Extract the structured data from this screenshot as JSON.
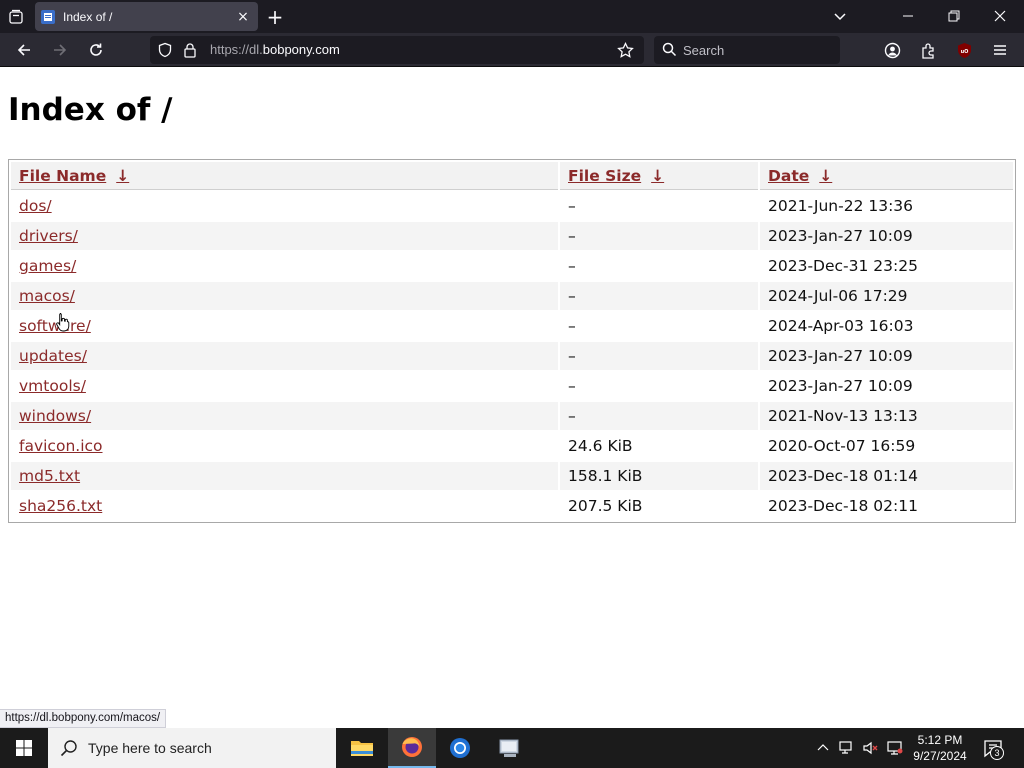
{
  "browser": {
    "tab": {
      "title": "Index of /",
      "close": "×"
    },
    "new_tab": "+",
    "url": {
      "prefix": "https://dl.",
      "domain": "bobpony.com"
    },
    "search_placeholder": "Search"
  },
  "page": {
    "heading": "Index of /",
    "columns": [
      {
        "label": "File Name",
        "arrow": "↓"
      },
      {
        "label": "File Size",
        "arrow": "↓"
      },
      {
        "label": "Date",
        "arrow": "↓"
      }
    ],
    "rows": [
      {
        "name": "dos/",
        "size": "–",
        "date": "2021-Jun-22 13:36"
      },
      {
        "name": "drivers/",
        "size": "–",
        "date": "2023-Jan-27 10:09"
      },
      {
        "name": "games/",
        "size": "–",
        "date": "2023-Dec-31 23:25"
      },
      {
        "name": "macos/",
        "size": "–",
        "date": "2024-Jul-06 17:29"
      },
      {
        "name": "software/",
        "size": "–",
        "date": "2024-Apr-03 16:03"
      },
      {
        "name": "updates/",
        "size": "–",
        "date": "2023-Jan-27 10:09"
      },
      {
        "name": "vmtools/",
        "size": "–",
        "date": "2023-Jan-27 10:09"
      },
      {
        "name": "windows/",
        "size": "–",
        "date": "2021-Nov-13 13:13"
      },
      {
        "name": "favicon.ico",
        "size": "24.6 KiB",
        "date": "2020-Oct-07 16:59"
      },
      {
        "name": "md5.txt",
        "size": "158.1 KiB",
        "date": "2023-Dec-18 01:14"
      },
      {
        "name": "sha256.txt",
        "size": "207.5 KiB",
        "date": "2023-Dec-18 02:11"
      }
    ]
  },
  "status_url": "https://dl.bobpony.com/macos/",
  "taskbar": {
    "search_placeholder": "Type here to search",
    "time": "5:12 PM",
    "date": "9/27/2024",
    "notification_count": "3"
  },
  "colors": {
    "link": "#8b2a2a",
    "chrome_dark": "#1c1b22",
    "toolbar": "#2b2a33",
    "taskbar": "#1b1b1b"
  }
}
